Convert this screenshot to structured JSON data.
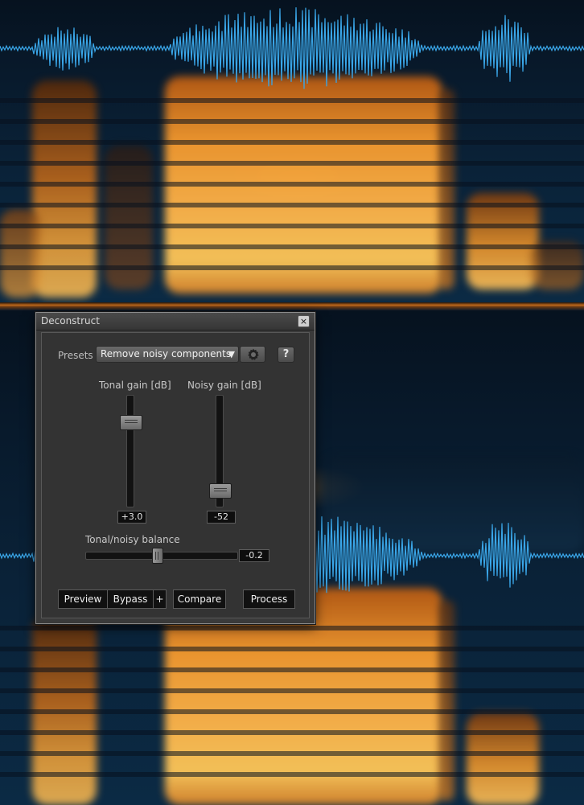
{
  "dialog": {
    "title": "Deconstruct",
    "close_label": "×",
    "presets": {
      "label": "Presets",
      "selected": "Remove noisy components",
      "dropdown_arrow": "▼",
      "gear_icon": "gear-icon",
      "help_label": "?"
    },
    "tonal_gain": {
      "label": "Tonal gain [dB]",
      "value": "+3.0"
    },
    "noisy_gain": {
      "label": "Noisy gain [dB]",
      "value": "-52"
    },
    "balance": {
      "label": "Tonal/noisy balance",
      "value": "-0.2"
    },
    "buttons": {
      "preview": "Preview",
      "bypass": "Bypass",
      "plus": "+",
      "compare": "Compare",
      "process": "Process"
    }
  },
  "colors": {
    "waveform": "#3aa6e8",
    "spectrogram_hot": "#ffb040",
    "spectrogram_cold": "#0a2238"
  }
}
